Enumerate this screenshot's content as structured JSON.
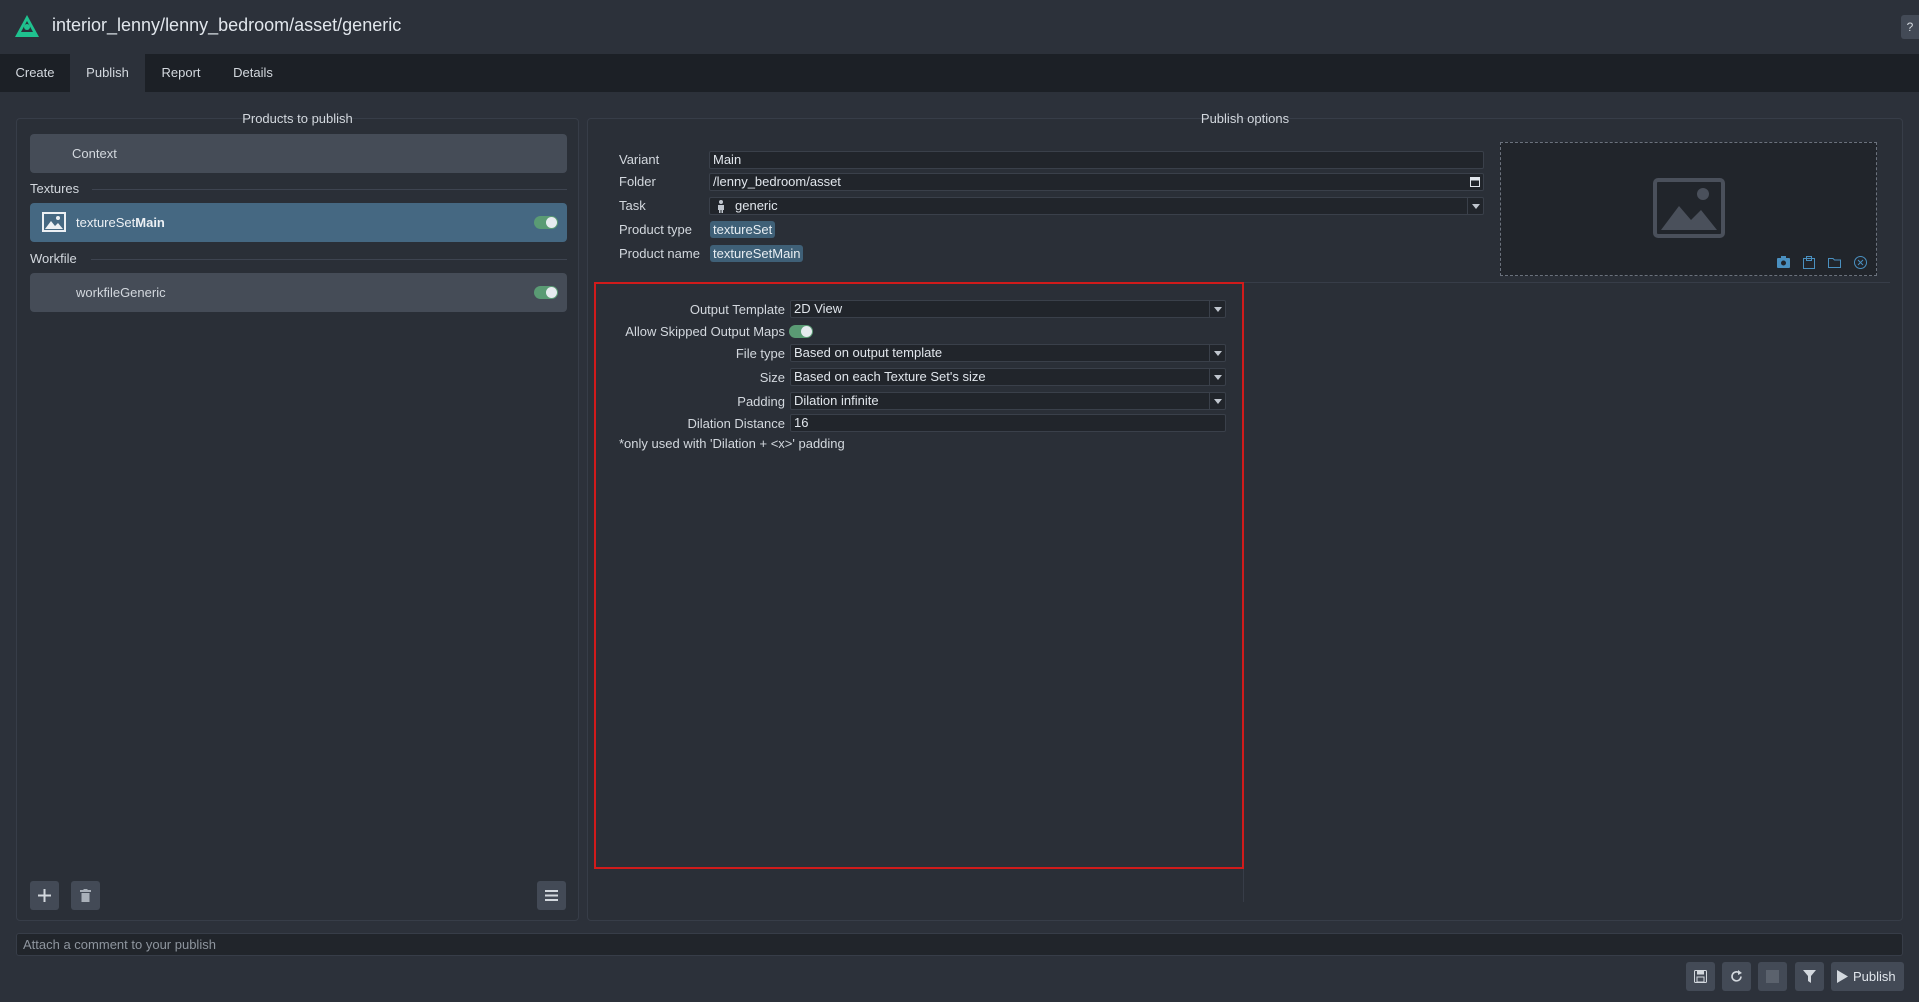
{
  "header": {
    "title": "interior_lenny/lenny_bedroom/asset/generic",
    "help_label": "?"
  },
  "tabs": [
    {
      "label": "Create",
      "active": false
    },
    {
      "label": "Publish",
      "active": true
    },
    {
      "label": "Report",
      "active": false
    },
    {
      "label": "Details",
      "active": false
    }
  ],
  "products": {
    "title": "Products to publish",
    "context_label": "Context",
    "groups": [
      {
        "label": "Textures",
        "items": [
          {
            "label_prefix": "textureSet",
            "label_bold": "Main",
            "enabled": true,
            "selected": true,
            "icon": "image-icon"
          }
        ]
      },
      {
        "label": "Workfile",
        "items": [
          {
            "label_prefix": "workfileGeneric",
            "label_bold": "",
            "enabled": true,
            "selected": false,
            "icon": ""
          }
        ]
      }
    ],
    "buttons": {
      "add": "plus-icon",
      "delete": "trash-icon",
      "menu": "menu-icon"
    }
  },
  "options": {
    "title": "Publish options",
    "variant_label": "Variant",
    "variant_value": "Main",
    "folder_label": "Folder",
    "folder_value": "/lenny_bedroom/asset",
    "task_label": "Task",
    "task_value": "generic",
    "product_type_label": "Product type",
    "product_type_value": "textureSet",
    "product_name_label": "Product name",
    "product_name_value": "textureSetMain",
    "thumbnail_icons": [
      "camera-icon",
      "clipboard-icon",
      "folder-icon",
      "close-circle-icon"
    ]
  },
  "creator_attrs": {
    "output_template_label": "Output Template",
    "output_template_value": "2D View",
    "allow_skipped_label": "Allow Skipped Output Maps",
    "allow_skipped_enabled": true,
    "file_type_label": "File type",
    "file_type_value": "Based on output template",
    "size_label": "Size",
    "size_value": "Based on each Texture Set's size",
    "padding_label": "Padding",
    "padding_value": "Dilation infinite",
    "dilation_label": "Dilation Distance",
    "dilation_value": "16",
    "note": "*only used with 'Dilation + <x>' padding"
  },
  "footer": {
    "comment_placeholder": "Attach a comment to your publish",
    "publish_label": "Publish",
    "icons": [
      "save-icon",
      "refresh-icon",
      "stop-icon",
      "filter-icon",
      "play-icon"
    ]
  },
  "colors": {
    "highlight_box": "#d01b1b",
    "toggle_on": "#5a9b74",
    "logo": "#1fc28f"
  }
}
